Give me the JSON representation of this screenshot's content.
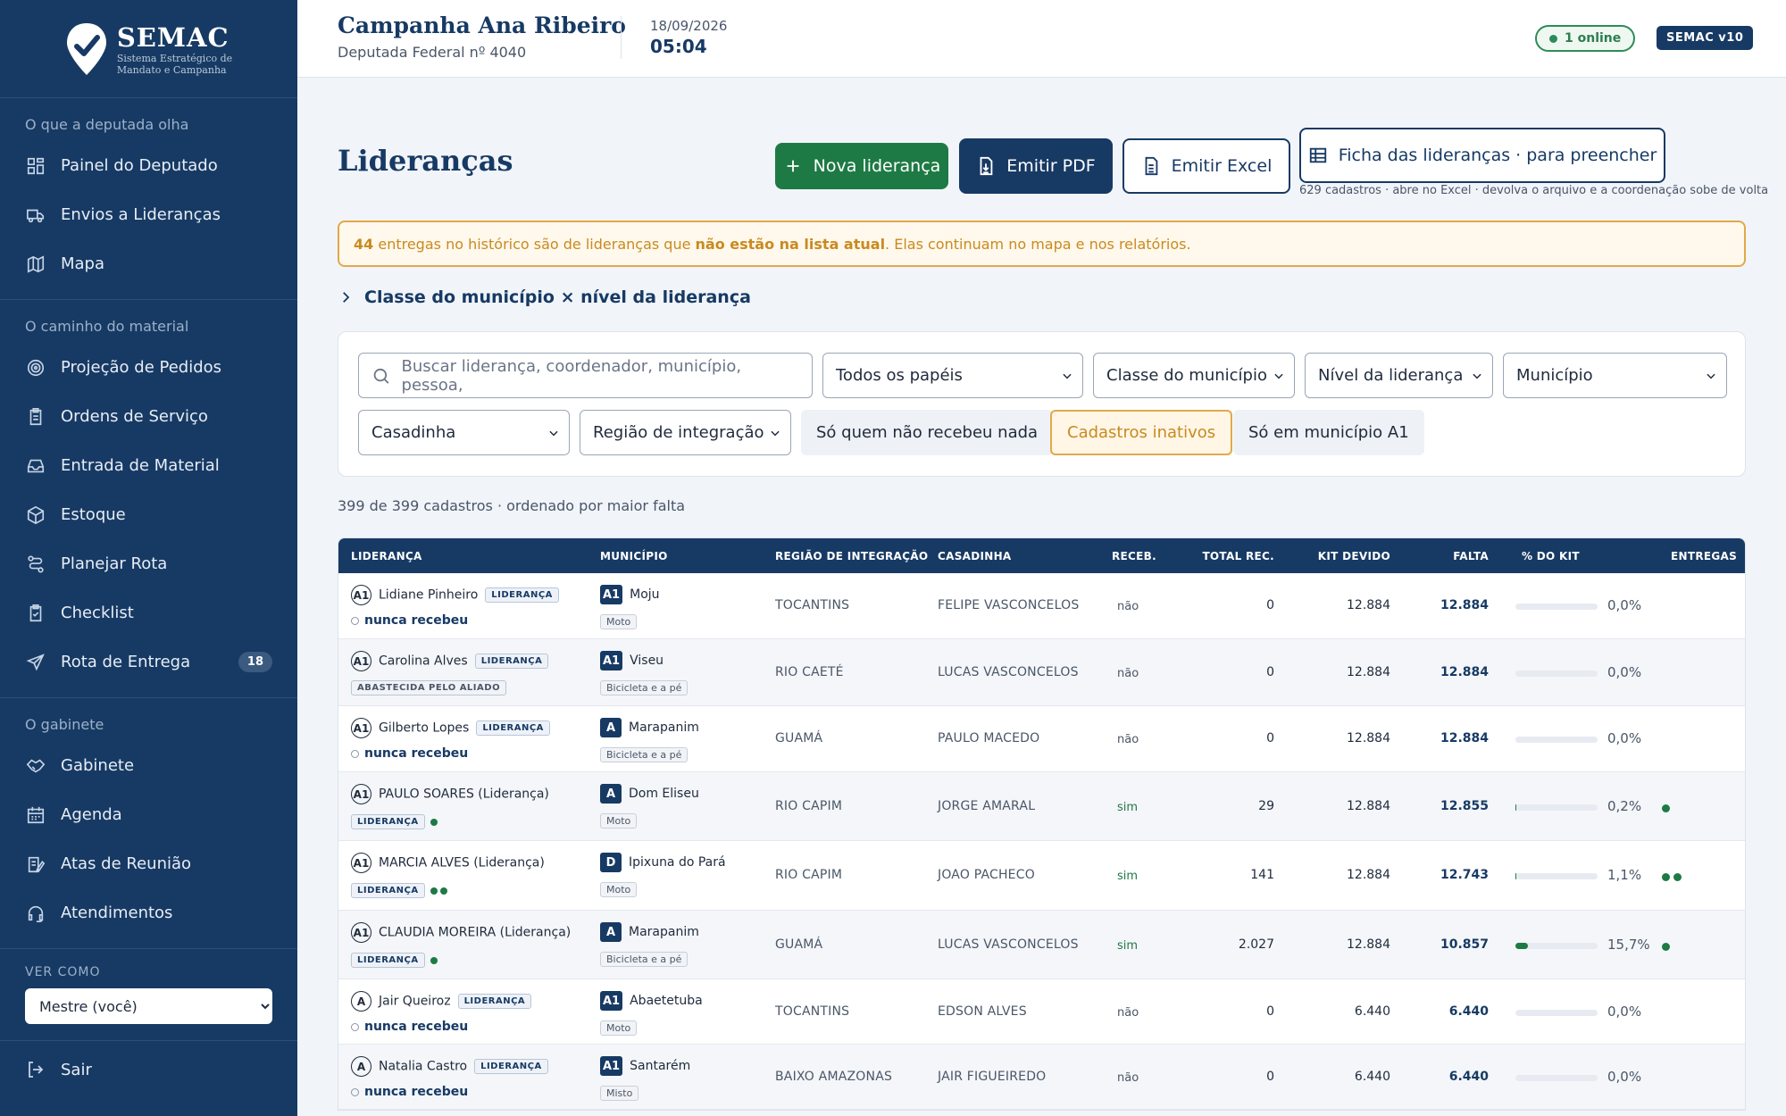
{
  "brand": {
    "name": "SEMAC",
    "subtitle_line1": "Sistema Estratégico de",
    "subtitle_line2": "Mandato e Campanha"
  },
  "sidebar": {
    "sections": [
      {
        "heading": "O que a deputada olha",
        "items": [
          {
            "label": "Painel do Deputado",
            "icon": "dashboard-icon"
          },
          {
            "label": "Envios a Lideranças",
            "icon": "truck-icon"
          },
          {
            "label": "Mapa",
            "icon": "map-icon"
          }
        ]
      },
      {
        "heading": "O caminho do material",
        "items": [
          {
            "label": "Projeção de Pedidos",
            "icon": "target-icon"
          },
          {
            "label": "Ordens de Serviço",
            "icon": "clipboard-icon"
          },
          {
            "label": "Entrada de Material",
            "icon": "inbox-icon"
          },
          {
            "label": "Estoque",
            "icon": "box-icon"
          },
          {
            "label": "Planejar Rota",
            "icon": "route-icon"
          },
          {
            "label": "Checklist",
            "icon": "checklist-icon"
          },
          {
            "label": "Rota de Entrega",
            "icon": "send-icon",
            "badge": "18"
          }
        ]
      },
      {
        "heading": "O gabinete",
        "items": [
          {
            "label": "Gabinete",
            "icon": "handshake-icon"
          },
          {
            "label": "Agenda",
            "icon": "calendar-icon"
          },
          {
            "label": "Atas de Reunião",
            "icon": "notes-icon"
          },
          {
            "label": "Atendimentos",
            "icon": "headset-icon"
          }
        ]
      }
    ],
    "view_as_label": "VER COMO",
    "view_as_value": "Mestre (você)",
    "logout": "Sair"
  },
  "topbar": {
    "campaign": "Campanha Ana Ribeiro",
    "subtitle": "Deputada Federal nº 4040",
    "date": "18/09/2026",
    "time": "05:04",
    "online": "1 online",
    "version": "SEMAC v10"
  },
  "page": {
    "title": "Lideranças",
    "buttons": {
      "new": "Nova liderança",
      "pdf": "Emitir PDF",
      "excel": "Emitir Excel",
      "ficha": "Ficha das lideranças · para preencher"
    },
    "ficha_note": "629 cadastros · abre no Excel · devolva o arquivo e a coordenação sobe de volta",
    "warning": {
      "count": "44",
      "text1": " entregas no histórico são de lideranças que ",
      "strong": "não estão na lista atual",
      "text2": ". Elas continuam no mapa e nos relatórios."
    },
    "classe_toggle": "Classe do município × nível da liderança",
    "filters": {
      "search_placeholder": "Buscar liderança, coordenador, município, pessoa,",
      "papeis": "Todos os papéis",
      "classe": "Classe do município",
      "nivel": "Nível da liderança",
      "municipio": "Município",
      "casadinha": "Casadinha",
      "regiao": "Região de integração",
      "chip_nada": "Só quem não recebeu nada",
      "chip_inativos": "Cadastros inativos",
      "chip_a1": "Só em município A1"
    },
    "count_text": "399 de 399 cadastros · ordenado por maior falta"
  },
  "table": {
    "headers": [
      "LIDERANÇA",
      "MUNICÍPIO",
      "REGIÃO DE INTEGRAÇÃO",
      "CASADINHA",
      "RECEB.",
      "TOTAL REC.",
      "KIT DEVIDO",
      "FALTA",
      "% DO KIT",
      "ENTREGAS"
    ],
    "never_label": "nunca recebeu",
    "lid_tag": "LIDERANÇA",
    "rows": [
      {
        "level": "A1",
        "name": "Lidiane Pinheiro",
        "inline_tag": true,
        "second": "never",
        "cls": "A1",
        "city": "Moju",
        "mode": "Moto",
        "region": "TOCANTINS",
        "casadinha": "FELIPE VASCONCELOS",
        "rec": "não",
        "total": "0",
        "kit": "12.884",
        "falta": "12.884",
        "pct": 0.0,
        "pct_label": "0,0%",
        "entregas": 0
      },
      {
        "level": "A1",
        "name": "Carolina Alves",
        "inline_tag": true,
        "second": "abast",
        "abast": "ABASTECIDA PELO ALIADO",
        "cls": "A1",
        "city": "Viseu",
        "mode": "Bicicleta e a pé",
        "region": "RIO CAETÉ",
        "casadinha": "LUCAS VASCONCELOS",
        "rec": "não",
        "total": "0",
        "kit": "12.884",
        "falta": "12.884",
        "pct": 0.0,
        "pct_label": "0,0%",
        "entregas": 0
      },
      {
        "level": "A1",
        "name": "Gilberto Lopes",
        "inline_tag": true,
        "second": "never",
        "cls": "A",
        "city": "Marapanim",
        "mode": "Bicicleta e a pé",
        "region": "GUAMÁ",
        "casadinha": "PAULO MACEDO",
        "rec": "não",
        "total": "0",
        "kit": "12.884",
        "falta": "12.884",
        "pct": 0.0,
        "pct_label": "0,0%",
        "entregas": 0
      },
      {
        "level": "A1",
        "name": "PAULO SOARES (Liderança)",
        "inline_tag": false,
        "second": "tag",
        "dots": 1,
        "cls": "A",
        "city": "Dom Eliseu",
        "mode": "Moto",
        "region": "RIO CAPIM",
        "casadinha": "JORGE AMARAL",
        "rec": "sim",
        "total": "29",
        "kit": "12.884",
        "falta": "12.855",
        "pct": 0.2,
        "pct_label": "0,2%",
        "entregas": 1
      },
      {
        "level": "A1",
        "name": "MARCIA ALVES (Liderança)",
        "inline_tag": false,
        "second": "tag",
        "dots": 2,
        "cls": "D",
        "city": "Ipixuna do Pará",
        "mode": "Moto",
        "region": "RIO CAPIM",
        "casadinha": "JOAO PACHECO",
        "rec": "sim",
        "total": "141",
        "kit": "12.884",
        "falta": "12.743",
        "pct": 1.1,
        "pct_label": "1,1%",
        "entregas": 2
      },
      {
        "level": "A1",
        "name": "CLAUDIA MOREIRA (Liderança)",
        "inline_tag": false,
        "second": "tag",
        "dots": 1,
        "cls": "A",
        "city": "Marapanim",
        "mode": "Bicicleta e a pé",
        "region": "GUAMÁ",
        "casadinha": "LUCAS VASCONCELOS",
        "rec": "sim",
        "total": "2.027",
        "kit": "12.884",
        "falta": "10.857",
        "pct": 15.7,
        "pct_label": "15,7%",
        "entregas": 1
      },
      {
        "level": "A",
        "name": "Jair Queiroz",
        "inline_tag": true,
        "second": "never",
        "cls": "A1",
        "city": "Abaetetuba",
        "mode": "Moto",
        "region": "TOCANTINS",
        "casadinha": "EDSON ALVES",
        "rec": "não",
        "total": "0",
        "kit": "6.440",
        "falta": "6.440",
        "pct": 0.0,
        "pct_label": "0,0%",
        "entregas": 0
      },
      {
        "level": "A",
        "name": "Natalia Castro",
        "inline_tag": true,
        "second": "never",
        "cls": "A1",
        "city": "Santarém",
        "mode": "Misto",
        "region": "BAIXO AMAZONAS",
        "casadinha": "JAIR FIGUEIREDO",
        "rec": "não",
        "total": "0",
        "kit": "6.440",
        "falta": "6.440",
        "pct": 0.0,
        "pct_label": "0,0%",
        "entregas": 0
      }
    ]
  }
}
